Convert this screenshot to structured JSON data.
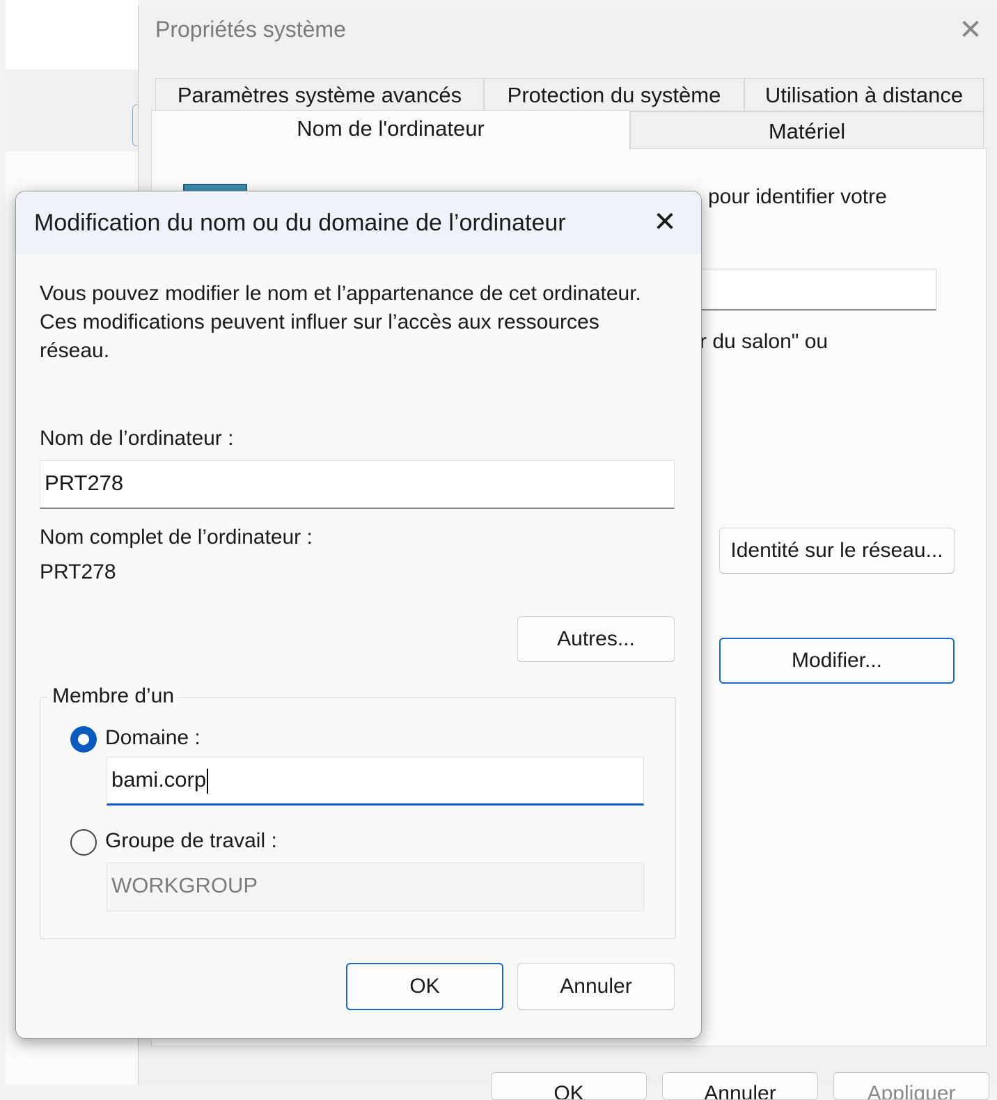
{
  "system_properties": {
    "title": "Propriétés système",
    "tabs_row1": [
      "Paramètres système avancés",
      "Protection du système",
      "Utilisation à distance"
    ],
    "tabs_row2": [
      "Nom de l'ordinateur",
      "Matériel"
    ],
    "active_tab": "Nom de l'ordinateur",
    "partial_text_1": "pour identifier votre",
    "partial_text_2": "r du salon\" ou",
    "network_id_button": "Identité sur le réseau...",
    "modify_button": "Modifier...",
    "bottom_buttons": [
      "OK",
      "Annuler",
      "Appliquer"
    ]
  },
  "dialog": {
    "title": "Modification du nom ou du domaine de l’ordinateur",
    "description": "Vous pouvez modifier le nom et l’appartenance de cet ordinateur. Ces modifications peuvent influer sur l’accès aux ressources réseau.",
    "computer_name_label": "Nom de l’ordinateur :",
    "computer_name_value": "PRT278",
    "full_name_label": "Nom complet de l’ordinateur :",
    "full_name_value": "PRT278",
    "more_button": "Autres...",
    "member_of_legend": "Membre d’un",
    "domain_label": "Domaine :",
    "domain_value": "bami.corp",
    "domain_selected": true,
    "workgroup_label": "Groupe de travail :",
    "workgroup_value": "WORKGROUP",
    "ok_button": "OK",
    "cancel_button": "Annuler"
  }
}
